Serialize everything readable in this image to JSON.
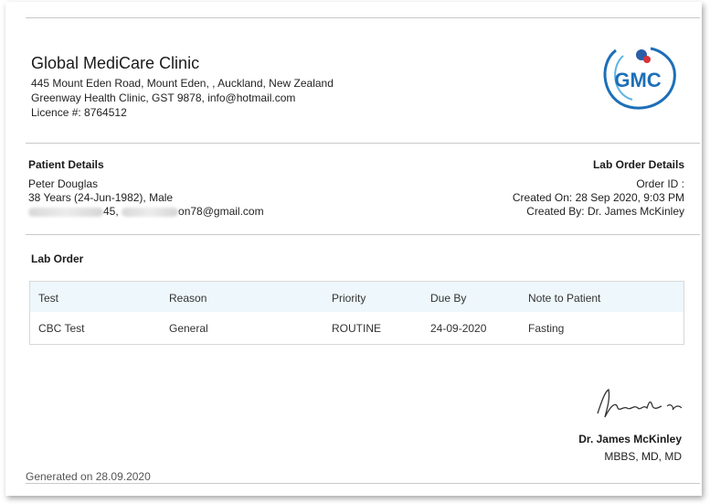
{
  "clinic": {
    "name": "Global MediCare Clinic",
    "address": "445 Mount Eden Road, Mount Eden, , Auckland, New Zealand",
    "details": "Greenway Health Clinic, GST 9878, info@hotmail.com",
    "licence": "Licence #: 8764512",
    "logo_text": "GMC"
  },
  "patient": {
    "title": "Patient Details",
    "name": "Peter Douglas",
    "age_dob_sex": "38 Years (24-Jun-1982), Male",
    "phone_suffix": "45,",
    "email_suffix": "on78@gmail.com"
  },
  "lab_order_details": {
    "title": "Lab Order Details",
    "order_id": "Order ID :",
    "created_on": "Created On: 28 Sep 2020, 9:03 PM",
    "created_by": "Created By: Dr. James McKinley"
  },
  "lab_order": {
    "title": "Lab Order",
    "columns": [
      "Test",
      "Reason",
      "Priority",
      "Due By",
      "Note to Patient"
    ],
    "rows": [
      [
        "CBC Test",
        "General",
        "ROUTINE",
        "24-09-2020",
        "Fasting"
      ]
    ]
  },
  "doctor": {
    "name": "Dr. James McKinley",
    "qualifications": "MBBS, MD, MD"
  },
  "footer": {
    "generated": "Generated on 28.09.2020"
  },
  "colors": {
    "logo_blue": "#1d6fb8",
    "table_header_bg": "#eef7fb",
    "rule": "#c9c9c9"
  }
}
